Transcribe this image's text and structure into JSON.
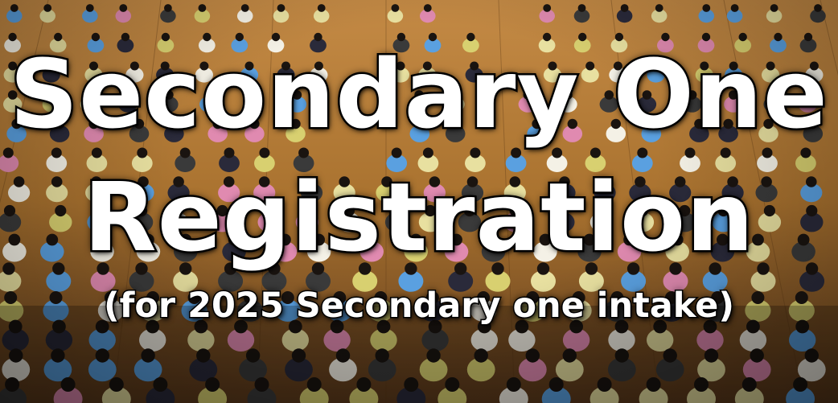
{
  "banner": {
    "title_line1": "Secondary One",
    "title_line2": "Registration",
    "subtitle": "(for 2025 Secondary one intake)"
  },
  "photo": {
    "subject": "crowd-seated-in-school-hall",
    "floor_color": "#b07a3c",
    "colors": [
      "#f4f1e6",
      "#e8e0a0",
      "#3a3a3a",
      "#5aa0e0",
      "#2a2a3a",
      "#d8d070",
      "#e08ab0"
    ]
  }
}
